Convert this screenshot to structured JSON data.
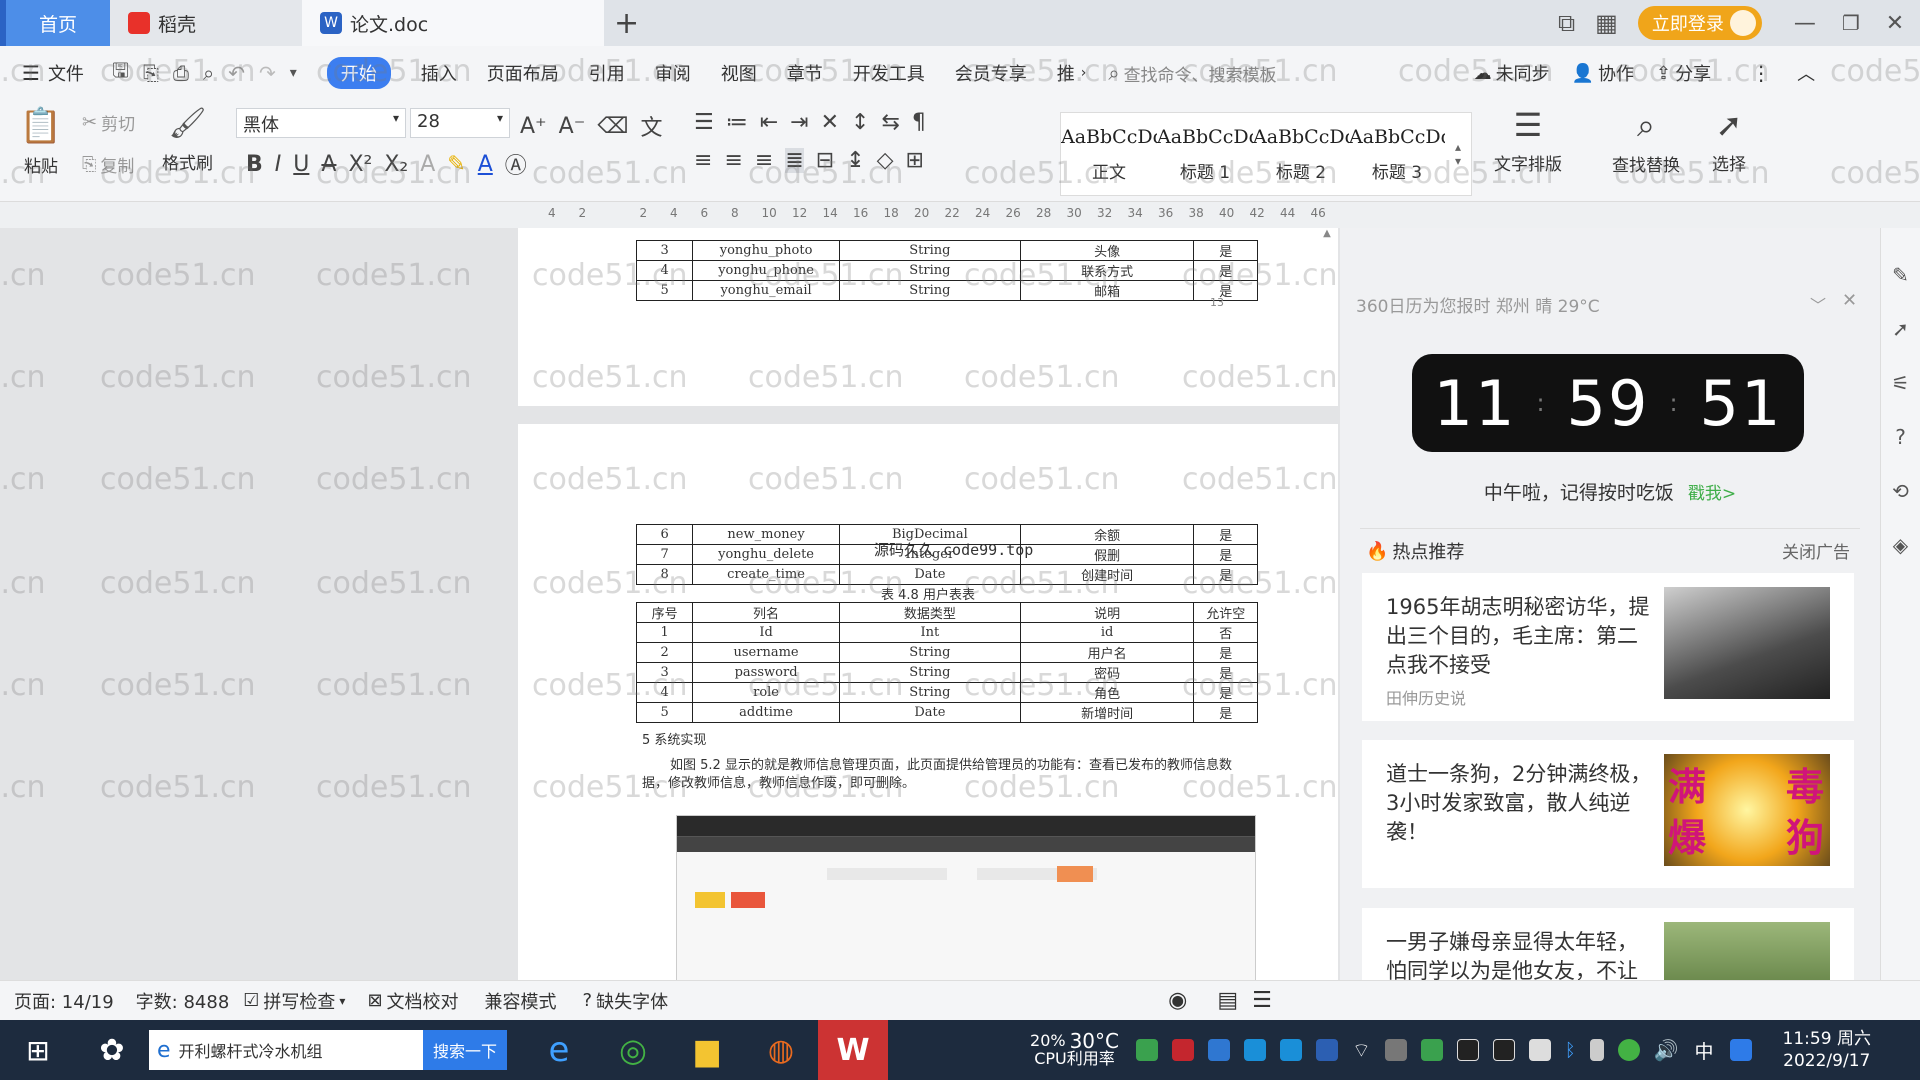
{
  "tabs": {
    "home": "首页",
    "daoke": "稻壳",
    "doc": "论文.doc",
    "add": "+"
  },
  "titlebar": {
    "login": "立即登录"
  },
  "menu": {
    "file": "文件",
    "items": [
      "开始",
      "插入",
      "页面布局",
      "引用",
      "审阅",
      "视图",
      "章节",
      "开发工具",
      "会员专享",
      "推"
    ],
    "search_cmd": "查找命令、搜索模板",
    "unsynced": "未同步",
    "collab": "协作",
    "share": "分享"
  },
  "ribbon": {
    "paste": "粘贴",
    "cut": "剪切",
    "copy": "复制",
    "format_painter": "格式刷",
    "font_name": "黑体",
    "font_size": "28",
    "styles": [
      {
        "preview": "AaBbCcDd",
        "name": "正文"
      },
      {
        "preview": "AaBbCcDd",
        "name": "标题 1"
      },
      {
        "preview": "AaBbCcDd",
        "name": "标题 2"
      },
      {
        "preview": "AaBbCcDd",
        "name": "标题 3"
      }
    ],
    "text_layout": "文字排版",
    "find_replace": "查找替换",
    "select": "选择"
  },
  "ruler": {
    "ticks": [
      "4",
      "2",
      "",
      "2",
      "4",
      "6",
      "8",
      "10",
      "12",
      "14",
      "16",
      "18",
      "20",
      "22",
      "24",
      "26",
      "28",
      "30",
      "32",
      "34",
      "36",
      "38",
      "40",
      "42",
      "44",
      "46"
    ]
  },
  "document": {
    "table_top": [
      [
        "3",
        "yonghu_photo",
        "String",
        "头像",
        "是"
      ],
      [
        "4",
        "yonghu_phone",
        "String",
        "联系方式",
        "是"
      ],
      [
        "5",
        "yonghu_email",
        "String",
        "邮箱",
        "是"
      ]
    ],
    "page_number": "13",
    "table_cont": [
      [
        "6",
        "new_money",
        "BigDecimal",
        "余额",
        "是"
      ],
      [
        "7",
        "yonghu_delete",
        "Integer",
        "假删",
        "是"
      ],
      [
        "8",
        "create_time",
        "Date",
        "创建时间",
        "是"
      ]
    ],
    "overlay_text": "源码久久 code99.top",
    "caption": "表 4.8 用户表表",
    "table_header": [
      "序号",
      "列名",
      "数据类型",
      "说明",
      "允许空"
    ],
    "table_users": [
      [
        "1",
        "Id",
        "Int",
        "id",
        "否"
      ],
      [
        "2",
        "username",
        "String",
        "用户名",
        "是"
      ],
      [
        "3",
        "password",
        "String",
        "密码",
        "是"
      ],
      [
        "4",
        "role",
        "String",
        "角色",
        "是"
      ],
      [
        "5",
        "addtime",
        "Date",
        "新增时间",
        "是"
      ]
    ],
    "section_heading": "5  系统实现",
    "paragraph": "如图 5.2 显示的就是教师信息管理页面，此页面提供给管理员的功能有：查看已发布的教师信息数据，修改教师信息，教师信息作废，即可删除。",
    "watermark": "code51.cn"
  },
  "sidebar": {
    "header": "360日历为您报时 郑州 晴 29°C",
    "clock": {
      "h": "11",
      "m": "59",
      "s": "51"
    },
    "reminder": "中午啦，记得按时吃饭",
    "reminder_link": "戳我>",
    "hot_title": "热点推荐",
    "close_ad": "关闭广告",
    "news": [
      {
        "title": "1965年胡志明秘密访华，提出三个目的，毛主席：第二点我不接受",
        "source": "田伸历史说"
      },
      {
        "title": "道士一条狗，2分钟满终极，3小时发家致富，散人纯逆袭！",
        "img_text": [
          "满",
          "毒",
          "爆",
          "狗"
        ]
      },
      {
        "title": "一男子嫌母亲显得太年轻，怕同学以为是他女友，不让"
      }
    ]
  },
  "statusbar": {
    "page": "页面: 14/19",
    "words": "字数: 8488",
    "spell": "拼写检查",
    "proof": "文档校对",
    "compat": "兼容模式",
    "missing_font": "缺失字体"
  },
  "taskbar": {
    "search_text": "开利螺杆式冷水机组",
    "search_button": "搜索一下",
    "cpu_pct": "20%",
    "temp": "30°C",
    "cpu_label": "CPU利用率",
    "ime": "中",
    "time": "11:59 周六",
    "date": "2022/9/17"
  },
  "colors": {
    "accent": "#3c7ef0",
    "wps_red": "#e8312a",
    "clock_bg": "#111111",
    "taskbar": "#1d2b3e"
  }
}
